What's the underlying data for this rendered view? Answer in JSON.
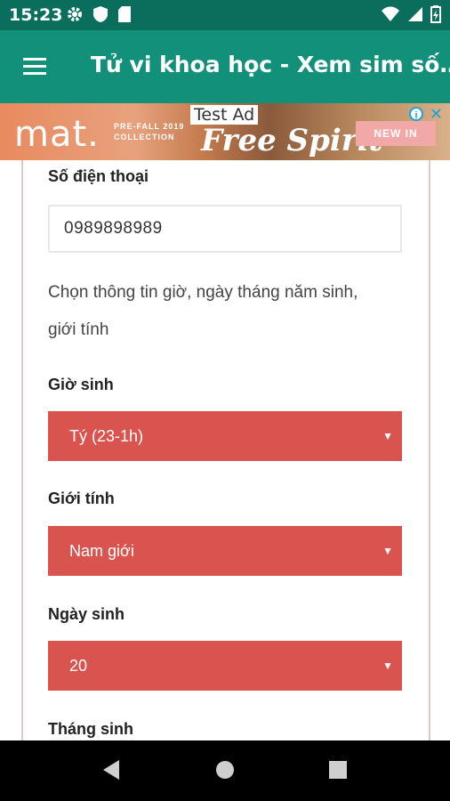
{
  "status_bar": {
    "time": "15:23",
    "icons_left": [
      "gear-icon",
      "shield-icon",
      "sd-card-icon"
    ],
    "icons_right": [
      "wifi-icon",
      "signal-icon",
      "battery-icon"
    ]
  },
  "app_bar": {
    "title": "Tử vi khoa học - Xem sim số…",
    "menu_icon": "hamburger-menu-icon",
    "color": "#12907a"
  },
  "ad": {
    "label": "Test Ad",
    "brand": "mat.",
    "sub_line1": "PRE-FALL 2019",
    "sub_line2": "COLLECTION",
    "headline": "Free Spirit",
    "cta": "NEW IN",
    "info_icon": "info-icon",
    "close_icon": "close-icon"
  },
  "form": {
    "phone_label": "Số điện thoại",
    "phone_value": "0989898989",
    "instruction": "Chọn thông tin giờ, ngày tháng năm sinh, giới tính",
    "birth_hour_label": "Giờ sinh",
    "birth_hour_value": "Tý (23-1h)",
    "gender_label": "Giới tính",
    "gender_value": "Nam giới",
    "birth_day_label": "Ngày sinh",
    "birth_day_value": "20",
    "birth_month_label": "Tháng sinh",
    "select_color": "#d9534f"
  },
  "nav_bar": {
    "back_icon": "back-triangle-icon",
    "home_icon": "home-circle-icon",
    "recent_icon": "recent-apps-square-icon"
  }
}
